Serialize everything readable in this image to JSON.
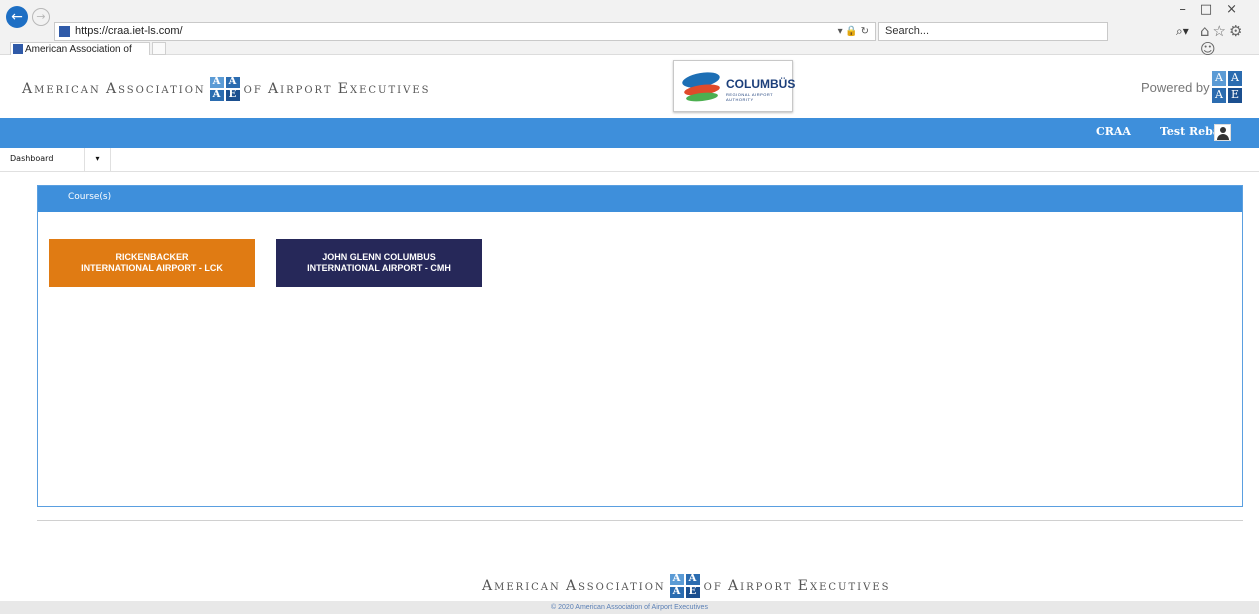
{
  "browser": {
    "url": "https://craa.iet-ls.com/",
    "search_placeholder": "Search...",
    "tab_title": "American Association of Ai...",
    "tab_close": "×"
  },
  "header": {
    "org_name_left": [
      "A",
      "MERICAN",
      "A",
      "SSOCIATION",
      "OF",
      "A",
      "IRPORT",
      "E",
      "XECUTIVES"
    ],
    "org_name_left_full": "American Association of Airport Executives",
    "columbus_name": "COLUMBÜS",
    "columbus_sub": "REGIONAL AIRPORT AUTHORITY",
    "powered_by": "Powered by",
    "logo_letters": [
      "A",
      "A",
      "A",
      "E"
    ]
  },
  "topbar": {
    "org": "CRAA",
    "user": "Test Reba"
  },
  "menu": {
    "dashboard": "Dashboard",
    "caret": "▾"
  },
  "courses_panel": {
    "title": "Course(s)",
    "courses": [
      {
        "line1": "RICKENBACKER",
        "line2": "INTERNATIONAL AIRPORT - LCK",
        "color": "#e07b13"
      },
      {
        "line1": "JOHN GLENN COLUMBUS",
        "line2": "INTERNATIONAL AIRPORT - CMH",
        "color": "#262859"
      }
    ]
  },
  "footer": {
    "copyright": "© 2020 American Association of Airport Executives"
  },
  "colors": {
    "accent_blue": "#3e8fdb",
    "orange": "#e07b13",
    "navy": "#262859"
  }
}
